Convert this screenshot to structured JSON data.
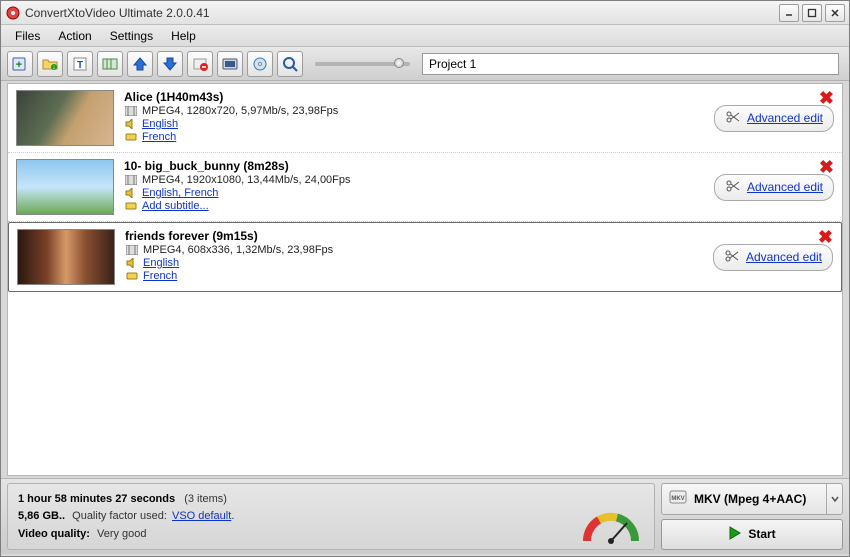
{
  "app": {
    "title": "ConvertXtoVideo Ultimate 2.0.0.41"
  },
  "menu": {
    "items": [
      "Files",
      "Action",
      "Settings",
      "Help"
    ]
  },
  "toolbar": {
    "icons": [
      "add-file",
      "add-folder",
      "add-text",
      "add-chapter",
      "move-up",
      "move-down",
      "remove",
      "screenshot",
      "disc",
      "preview"
    ],
    "project_value": "Project 1"
  },
  "files": [
    {
      "title": "Alice (1H40m43s)",
      "spec": "MPEG4, 1280x720, 5,97Mb/s, 23,98Fps",
      "audio": "English",
      "subtitle": "French",
      "adv": "Advanced edit"
    },
    {
      "title": "10- big_buck_bunny (8m28s)",
      "spec": "MPEG4, 1920x1080, 13,44Mb/s, 24,00Fps",
      "audio": "English, French",
      "subtitle": "Add subtitle...",
      "adv": "Advanced edit"
    },
    {
      "title": "friends forever (9m15s)",
      "spec": "MPEG4, 608x336, 1,32Mb/s, 23,98Fps",
      "audio": "English",
      "subtitle": "French",
      "adv": "Advanced edit"
    }
  ],
  "summary": {
    "duration": "1 hour 58 minutes 27 seconds",
    "items_count": "(3 items)",
    "size_line_a": "5,86 GB..",
    "size_line_b": "Quality factor used:",
    "size_line_c": "VSO default",
    "quality_label": "Video quality:",
    "quality_value": "Very good"
  },
  "output": {
    "format": "MKV (Mpeg 4+AAC)",
    "start": "Start"
  }
}
